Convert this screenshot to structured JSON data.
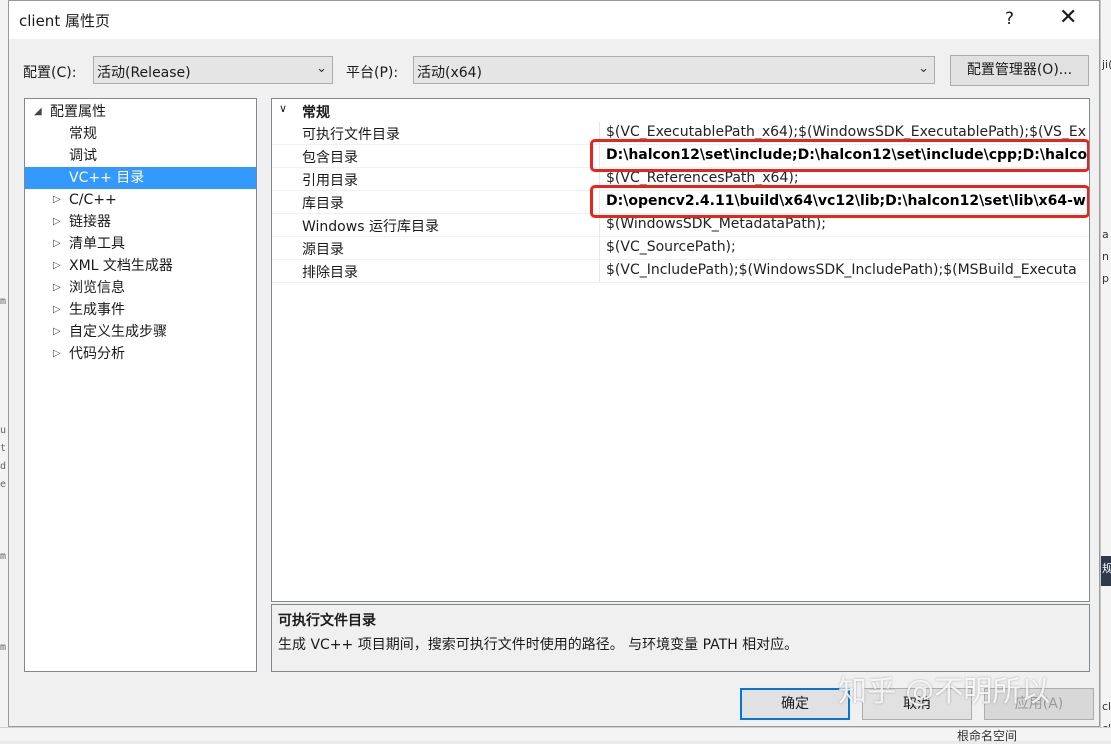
{
  "background": {
    "left_fragments": [
      "m",
      "u",
      "t",
      "d",
      "e",
      "m",
      "m"
    ],
    "right_fragments": [
      "ji(",
      "a",
      "n",
      "p",
      "规",
      "cl",
      "cl"
    ],
    "bottom_text": "根命名空间"
  },
  "window": {
    "title": "client 属性页",
    "help_label": "?",
    "close_label": "✕"
  },
  "config": {
    "config_label": "配置(C):",
    "config_value": "活动(Release)",
    "platform_label": "平台(P):",
    "platform_value": "活动(x64)",
    "manager_button": "配置管理器(O)..."
  },
  "tree": {
    "items": [
      {
        "label": "配置属性",
        "twisty": "◢"
      },
      {
        "label": "常规",
        "twisty": ""
      },
      {
        "label": "调试",
        "twisty": ""
      },
      {
        "label": "VC++ 目录",
        "twisty": ""
      },
      {
        "label": "C/C++",
        "twisty": "▷"
      },
      {
        "label": "链接器",
        "twisty": "▷"
      },
      {
        "label": "清单工具",
        "twisty": "▷"
      },
      {
        "label": "XML 文档生成器",
        "twisty": "▷"
      },
      {
        "label": "浏览信息",
        "twisty": "▷"
      },
      {
        "label": "生成事件",
        "twisty": "▷"
      },
      {
        "label": "自定义生成步骤",
        "twisty": "▷"
      },
      {
        "label": "代码分析",
        "twisty": "▷"
      }
    ],
    "selected_label": "VC++ 目录"
  },
  "grid": {
    "category": "常规",
    "category_chevron": "∨",
    "rows": [
      {
        "name": "可执行文件目录",
        "value": "$(VC_ExecutablePath_x64);$(WindowsSDK_ExecutablePath);$(VS_Ex"
      },
      {
        "name": "包含目录",
        "value": "D:\\halcon12\\set\\include;D:\\halcon12\\set\\include\\cpp;D:\\halcon"
      },
      {
        "name": "引用目录",
        "value": "$(VC_ReferencesPath_x64);"
      },
      {
        "name": "库目录",
        "value": "D:\\opencv2.4.11\\build\\x64\\vc12\\lib;D:\\halcon12\\set\\lib\\x64-win"
      },
      {
        "name": "Windows 运行库目录",
        "value": "$(WindowsSDK_MetadataPath);"
      },
      {
        "name": "源目录",
        "value": "$(VC_SourcePath);"
      },
      {
        "name": "排除目录",
        "value": "$(VC_IncludePath);$(WindowsSDK_IncludePath);$(MSBuild_Executa"
      }
    ],
    "highlight_color": "#e8241d"
  },
  "description": {
    "title": "可执行文件目录",
    "text": "生成 VC++ 项目期间，搜索可执行文件时使用的路径。 与环境变量 PATH 相对应。"
  },
  "buttons": {
    "ok": "确定",
    "cancel": "取消",
    "apply": "应用(A)"
  },
  "watermark": "知乎 @不明所以"
}
